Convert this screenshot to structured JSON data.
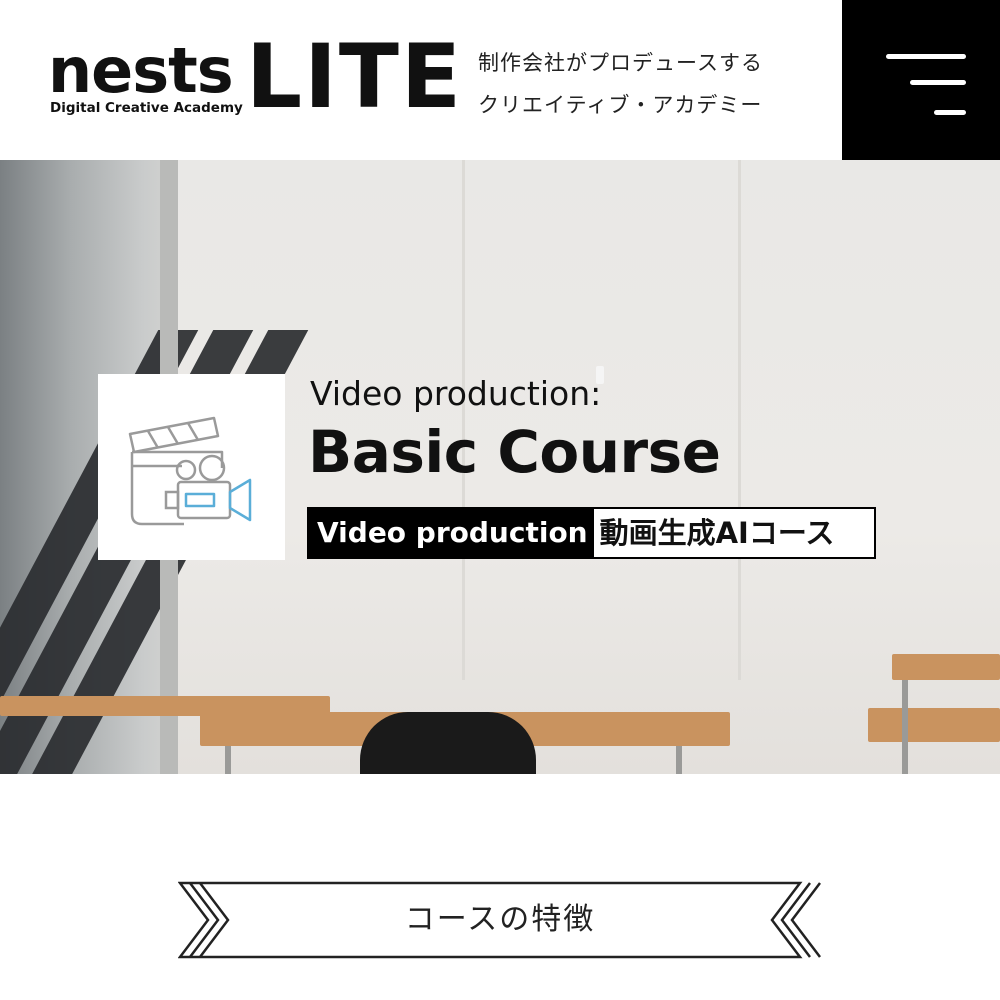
{
  "header": {
    "logo_main": "nests",
    "logo_sub": "Digital Creative Academy",
    "logo_lite": "LITE",
    "tagline_line1": "制作会社がプロデュースする",
    "tagline_line2": "クリエイティブ・アカデミー",
    "menu_icon": "hamburger-menu-icon"
  },
  "hero": {
    "course_icon": "video-camera-clapperboard-icon",
    "subtitle": "Video production:",
    "title": "Basic Course",
    "tag_black": "Video production",
    "tag_white": "動画生成AIコース"
  },
  "section": {
    "title": "コースの特徴"
  },
  "colors": {
    "primary": "#000000",
    "background": "#ffffff",
    "icon_accent": "#5aaed8",
    "icon_line": "#9a9a9a"
  }
}
